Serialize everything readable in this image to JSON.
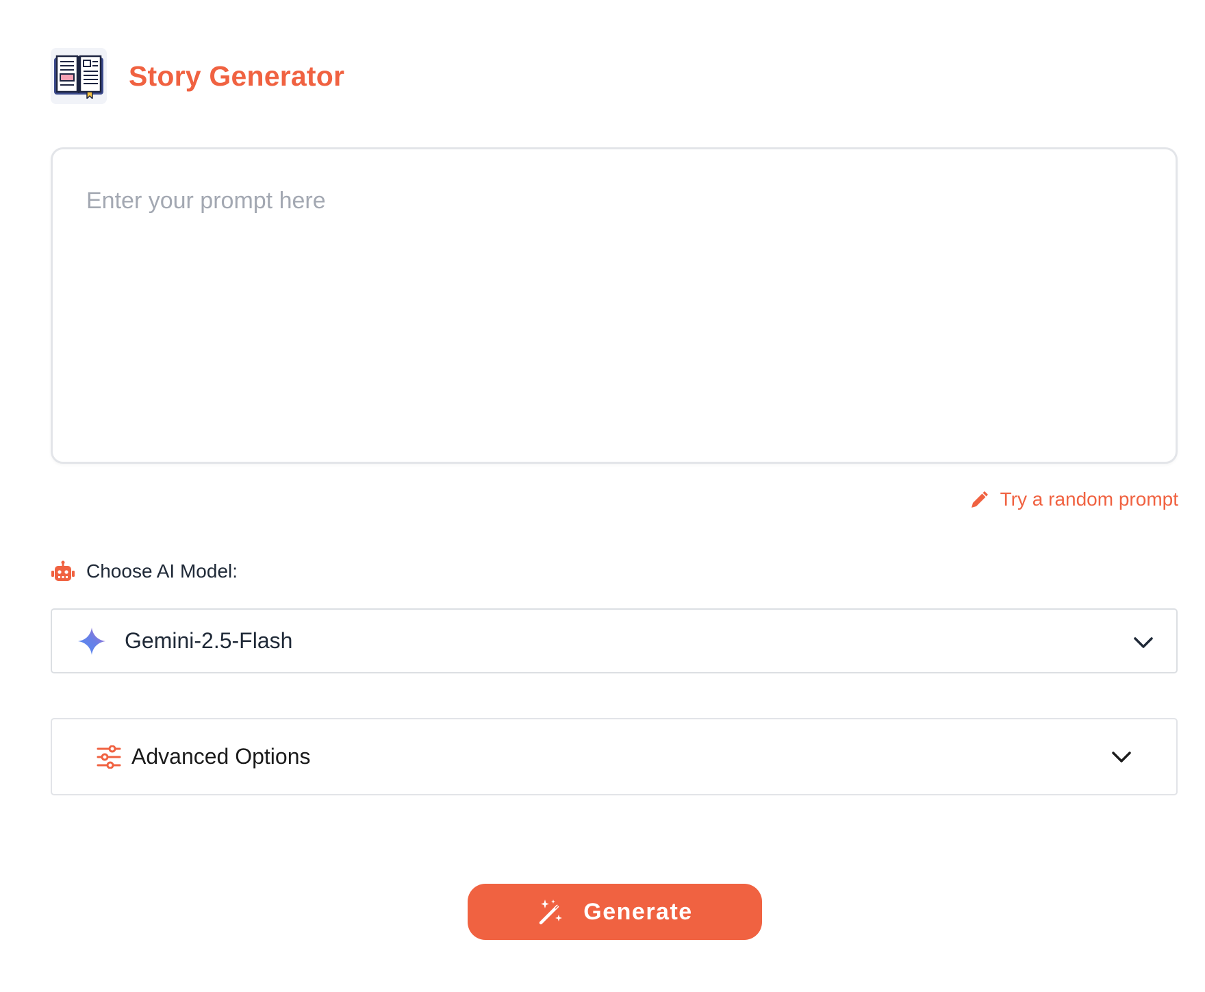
{
  "header": {
    "title": "Story Generator",
    "logo_icon": "open-book-icon"
  },
  "prompt": {
    "placeholder": "Enter your prompt here",
    "value": ""
  },
  "random_prompt": {
    "label": "Try a random prompt",
    "icon": "pencil-icon"
  },
  "model": {
    "label": "Choose AI Model:",
    "label_icon": "robot-icon",
    "selected": "Gemini-2.5-Flash",
    "selected_icon": "gemini-sparkle-icon"
  },
  "advanced": {
    "label": "Advanced Options",
    "icon": "sliders-icon",
    "expanded": false
  },
  "generate": {
    "label": "Generate",
    "icon": "magic-wand-icon"
  },
  "colors": {
    "accent": "#f06241",
    "text": "#1f2937",
    "placeholder": "#a3a8b2",
    "border": "#e3e5e9"
  }
}
